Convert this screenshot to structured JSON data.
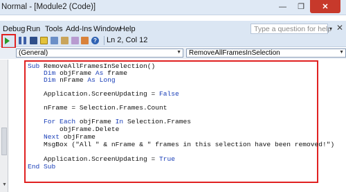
{
  "window": {
    "title": "Normal - [Module2 (Code)]",
    "minimize_glyph": "—",
    "maximize_glyph": "❐",
    "close_glyph": "✕"
  },
  "menu": {
    "items": [
      "Debug",
      "Run",
      "Tools",
      "Add-Ins",
      "Window",
      "Help"
    ],
    "help_placeholder": "Type a question for help",
    "help_dropdown_glyph": "▾",
    "close_glyph": "✕"
  },
  "toolbar": {
    "position": "Ln 2, Col 12",
    "help_glyph": "?",
    "icons": [
      "run-icon",
      "pause-icon",
      "stop-icon",
      "design-mode-icon",
      "project-explorer-icon",
      "properties-icon",
      "object-browser-icon",
      "toolbox-icon",
      "help-icon"
    ]
  },
  "combos": {
    "object": "(General)",
    "procedure": "RemoveAllFramesInSelection",
    "arrow_glyph": "▼"
  },
  "code": {
    "line1": {
      "kw": "Sub",
      "rest": " RemoveAllFramesInSelection()"
    },
    "line2": {
      "kw1": "    Dim",
      "mid": " objFrame ",
      "kw2": "As",
      "rest": " frame"
    },
    "line3": {
      "kw1": "    Dim",
      "mid": " nFrame ",
      "kw2": "As Long",
      "rest": ""
    },
    "line4": {
      "pre": "    Application.ScreenUpdating = ",
      "kw": "False"
    },
    "line5": {
      "text": "    nFrame = Selection.Frames.Count"
    },
    "line6": {
      "kw1": "    For Each",
      "mid": " objFrame ",
      "kw2": "In",
      "rest": " Selection.Frames"
    },
    "line7": {
      "text": "        objFrame.Delete"
    },
    "line8": {
      "kw": "    Next",
      "rest": " objFrame"
    },
    "line9": {
      "text": "    MsgBox (\"All \" & nFrame & \" frames in this selection have been removed!\")"
    },
    "line10": {
      "pre": "    Application.ScreenUpdating = ",
      "kw": "True"
    },
    "line11": {
      "kw": "End Sub"
    }
  },
  "colors": {
    "keyword": "#1a3fb8",
    "highlight_box": "#e02020",
    "close_button": "#c7392b",
    "run_green": "#2a9a2a"
  }
}
